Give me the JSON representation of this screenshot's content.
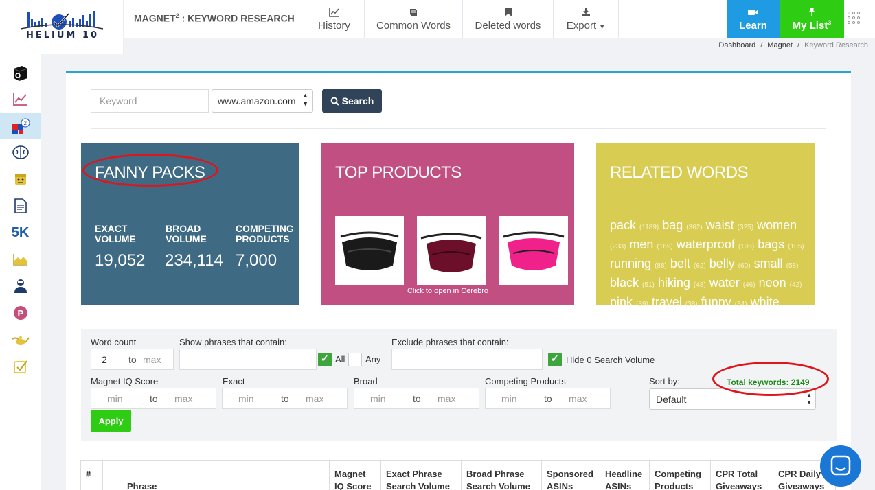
{
  "brand": {
    "logo_text": "HELIUM 10"
  },
  "header": {
    "title_main": "MAGNET",
    "title_sup": "2",
    "title_rest": " : KEYWORD RESEARCH",
    "nav": [
      {
        "label": "History",
        "icon": "line-chart-icon"
      },
      {
        "label": "Common Words",
        "icon": "book-icon"
      },
      {
        "label": "Deleted words",
        "icon": "bookmark-icon"
      },
      {
        "label": "Export",
        "icon": "download-icon"
      }
    ],
    "learn_label": "Learn",
    "mylist_label": "My List",
    "mylist_count": "3"
  },
  "breadcrumb": [
    "Dashboard",
    "Magnet",
    "Keyword Research"
  ],
  "sidebar": {
    "items": [
      "black-box-icon",
      "trendster-icon",
      "magnet-icon",
      "cerebro-icon",
      "frankenstein-icon",
      "scribbles-icon",
      "index-checker-icon",
      "keyword-tracker-icon",
      "inventory-protector-icon",
      "profits-icon",
      "genie-icon",
      "alerts-icon"
    ],
    "index_label": "5K",
    "magnet_badge": "2"
  },
  "search": {
    "placeholder": "Keyword",
    "marketplace": "www.amazon.com",
    "button_label": "Search"
  },
  "keyword_card": {
    "title": "FANNY PACKS",
    "stats": [
      {
        "label_line1": "EXACT",
        "label_line2": "VOLUME",
        "value": "19,052"
      },
      {
        "label_line1": "BROAD",
        "label_line2": "VOLUME",
        "value": "234,114"
      },
      {
        "label_line1": "COMPETING",
        "label_line2": "PRODUCTS",
        "value": "7,000"
      }
    ]
  },
  "top_products": {
    "title": "TOP PRODUCTS",
    "caption": "Click to open in Cerebro",
    "products": [
      "black fanny pack",
      "maroon fanny pack",
      "pink fanny pack"
    ]
  },
  "related_words": {
    "title": "RELATED WORDS",
    "words": [
      {
        "w": "pack",
        "n": "(1189)"
      },
      {
        "w": "bag",
        "n": "(362)"
      },
      {
        "w": "waist",
        "n": "(325)"
      },
      {
        "w": "women",
        "n": "(233)"
      },
      {
        "w": "men",
        "n": "(169)"
      },
      {
        "w": "waterproof",
        "n": "(106)"
      },
      {
        "w": "bags",
        "n": "(105)"
      },
      {
        "w": "running",
        "n": "(88)"
      },
      {
        "w": "belt",
        "n": "(62)"
      },
      {
        "w": "belly",
        "n": "(60)"
      },
      {
        "w": "small",
        "n": "(58)"
      },
      {
        "w": "black",
        "n": "(51)"
      },
      {
        "w": "hiking",
        "n": "(48)"
      },
      {
        "w": "water",
        "n": "(46)"
      },
      {
        "w": "neon",
        "n": "(42)"
      },
      {
        "w": "pink",
        "n": "(39)"
      },
      {
        "w": "travel",
        "n": "(38)"
      },
      {
        "w": "funny",
        "n": "(34)"
      },
      {
        "w": "white",
        "n": ""
      }
    ]
  },
  "filters": {
    "word_count_label": "Word count",
    "word_count_min": "2",
    "word_count_to": "to",
    "word_count_max": "max",
    "contain_label": "Show phrases that contain:",
    "all_label": "All",
    "any_label": "Any",
    "exclude_label": "Exclude phrases that contain:",
    "hide_zero_label": "Hide 0 Search Volume",
    "iq_label": "Magnet IQ Score",
    "exact_label": "Exact",
    "broad_label": "Broad",
    "competing_label": "Competing Products",
    "min": "min",
    "to": "to",
    "max": "max",
    "sort_label": "Sort by:",
    "sort_value": "Default",
    "apply_label": "Apply",
    "total_keywords": "Total keywords: 2149"
  },
  "table": {
    "headers": [
      {
        "l1": "#",
        "l2": ""
      },
      {
        "l1": "",
        "l2": ""
      },
      {
        "l1": "Phrase",
        "l2": ""
      },
      {
        "l1": "Magnet",
        "l2": "IQ Score"
      },
      {
        "l1": "Exact Phrase",
        "l2": "Search Volume"
      },
      {
        "l1": "Broad Phrase",
        "l2": "Search Volume"
      },
      {
        "l1": "Sponsored",
        "l2": "ASINs"
      },
      {
        "l1": "Headline",
        "l2": "ASINs"
      },
      {
        "l1": "Competing",
        "l2": "Products"
      },
      {
        "l1": "CPR Total",
        "l2": "Giveaways"
      },
      {
        "l1": "CPR Daily",
        "l2": "Giveaways"
      }
    ]
  },
  "colors": {
    "accent_blue": "#1e9be2",
    "accent_green": "#2fcc14",
    "card_teal": "#3e6a84",
    "card_pink": "#c24f82",
    "card_yellow": "#d8cc52",
    "highlight_red": "#e0141b"
  }
}
